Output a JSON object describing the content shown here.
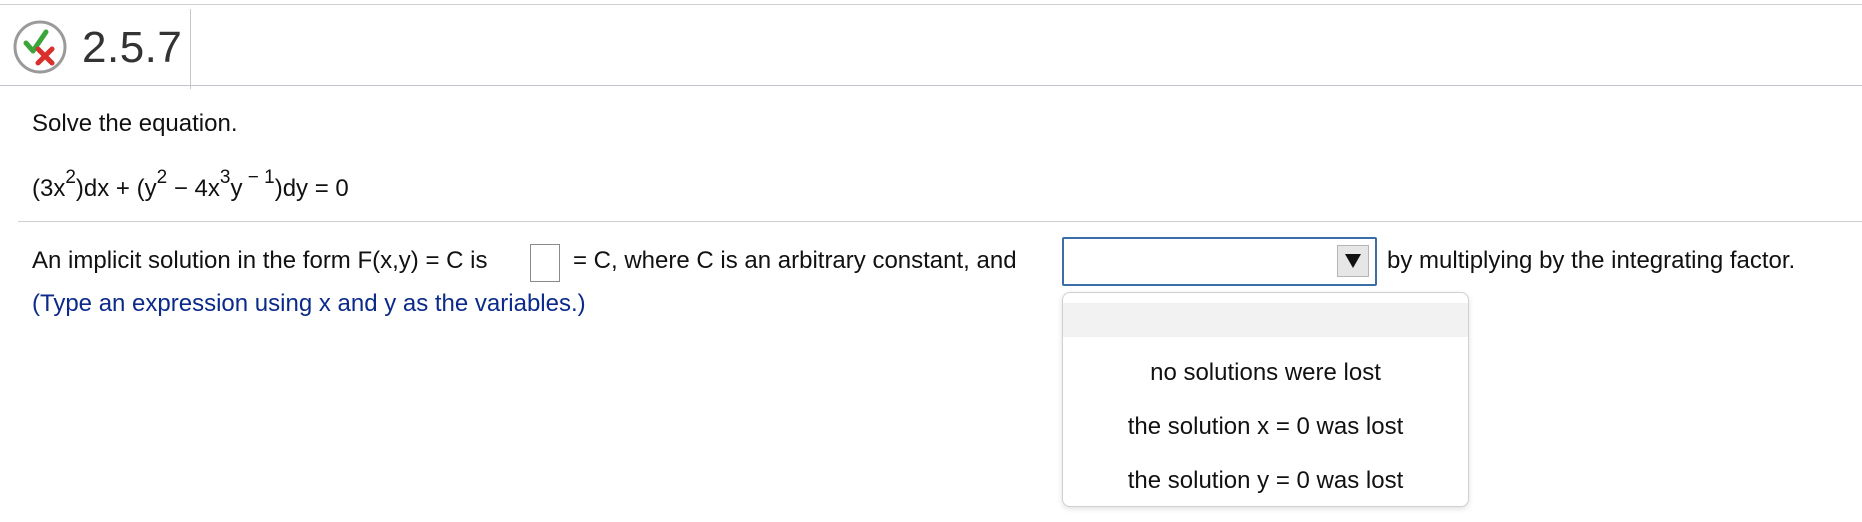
{
  "header": {
    "problem_number": "2.5.7",
    "status_icon": "partial-correct-icon",
    "colors": {
      "check": "#3aa53a",
      "cross": "#d9302c",
      "ring": "#9a9a9a"
    }
  },
  "question": {
    "instruction": "Solve the equation.",
    "equation": {
      "p1": "(3x",
      "s1": "2",
      "p2": ")dx + (y",
      "s2": "2",
      "p3": " − 4x",
      "s3": "3",
      "p4": "y",
      "s4": " − 1",
      "p5": ")dy = 0"
    }
  },
  "answer": {
    "text_before_box": "An implicit solution in the form F(x,y) = C is",
    "box_value": "",
    "text_after_box": "= C, where C is an arbitrary constant, and",
    "dropdown_selected": "",
    "text_after_dropdown": "by multiplying by the integrating factor.",
    "hint": "(Type an expression using x and y as the variables.)"
  },
  "dropdown_menu": {
    "options": [
      "",
      "no solutions were lost",
      "the solution x = 0 was lost",
      "the solution y = 0 was lost"
    ]
  },
  "theme": {
    "hint_color": "#0b2a8a",
    "dropdown_border": "#3b6ea8"
  }
}
